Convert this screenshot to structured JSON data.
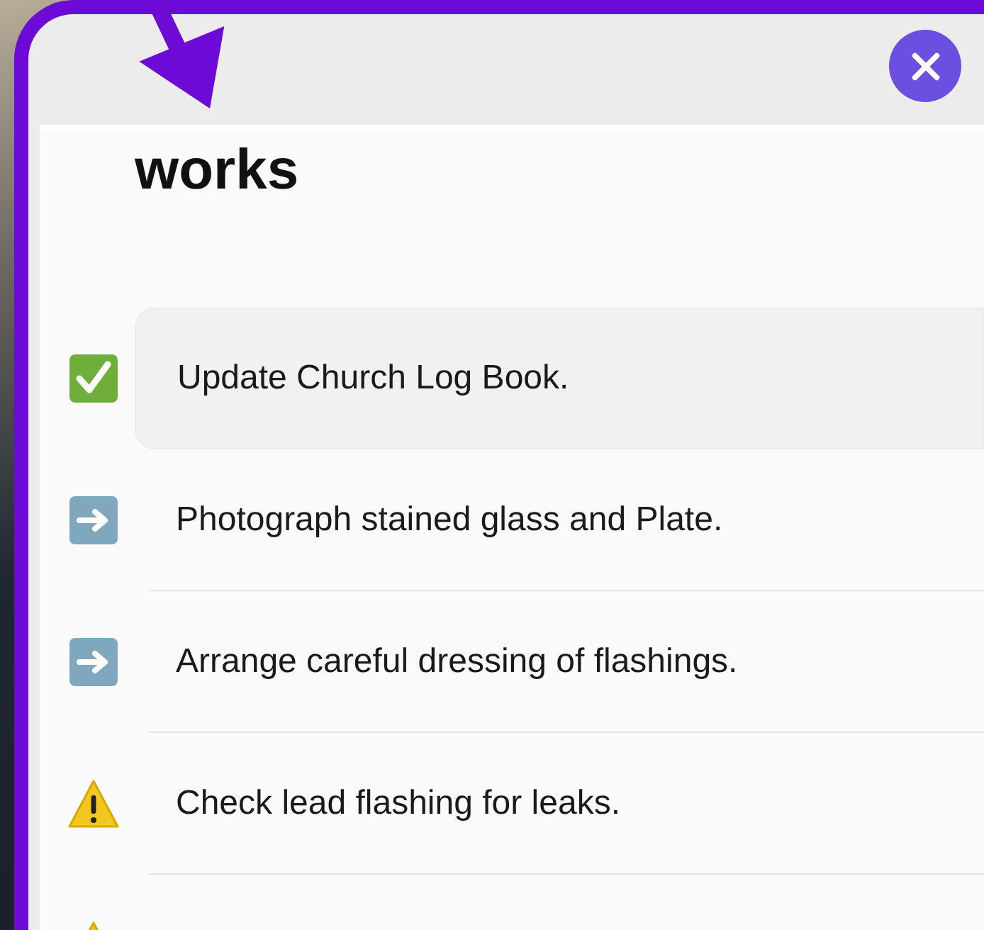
{
  "title": "works",
  "items": [
    {
      "kind": "done",
      "text": "Update Church Log Book.",
      "selected": true
    },
    {
      "kind": "next",
      "text": "Photograph stained glass and Plate.",
      "selected": false
    },
    {
      "kind": "next",
      "text": "Arrange careful dressing of flashings.",
      "selected": false
    },
    {
      "kind": "warning",
      "text": "Check lead flashing for leaks.",
      "selected": false
    },
    {
      "kind": "warning",
      "selected": false
    }
  ]
}
